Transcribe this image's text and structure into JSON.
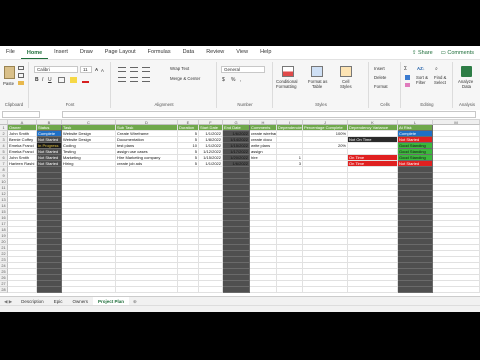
{
  "menu": {
    "tabs": [
      "File",
      "Home",
      "Insert",
      "Draw",
      "Page Layout",
      "Formulas",
      "Data",
      "Review",
      "View",
      "Help"
    ],
    "active": "Home",
    "share": "Share",
    "comments": "Comments"
  },
  "ribbon": {
    "clipboard": {
      "label": "Clipboard",
      "paste": "Paste"
    },
    "font": {
      "label": "Font",
      "name": "Calibri",
      "size": "11",
      "bold": "B",
      "italic": "I",
      "underline": "U"
    },
    "alignment": {
      "label": "Alignment",
      "wrap_text": "Wrap Text",
      "merge_center": "Merge & Center"
    },
    "number": {
      "label": "Number",
      "format": "General",
      "currency": "$",
      "percent": "%",
      "comma": ","
    },
    "styles": {
      "label": "Styles",
      "conditional": "Conditional",
      "conditional2": "Formatting",
      "format_table": "Format as",
      "format_table2": "Table",
      "cell_styles": "Cell",
      "cell_styles2": "Styles"
    },
    "cells": {
      "label": "Cells",
      "insert": "Insert",
      "delete": "Delete",
      "format": "Format"
    },
    "editing": {
      "label": "Editing",
      "sort": "Sort &",
      "sort2": "Filter",
      "find": "Find &",
      "find2": "Select"
    },
    "analysis": {
      "label": "Analysis",
      "analyze": "Analyze",
      "analyze2": "Data"
    }
  },
  "columns": [
    "A",
    "B",
    "C",
    "D",
    "E",
    "F",
    "G",
    "H",
    "I",
    "J",
    "K",
    "L",
    "M"
  ],
  "header_row": [
    "Owner",
    "Status",
    "Task",
    "Sub Task",
    "Duration",
    "Start Date",
    "End Date",
    "Comments",
    "Dependencies",
    "Percentage Complete",
    "Dependency Variance",
    "At Risk"
  ],
  "rows": [
    [
      "John Smith",
      "Complete",
      "Website Design",
      "Create Wireframe",
      "5",
      "1/1/2022",
      "1/6/2022",
      "create wireframe using t",
      "",
      "100%",
      "",
      "Complete"
    ],
    [
      "Bernie Coffey",
      "Not Started",
      "Website Design",
      "Documentation",
      "5",
      "1/8/2022",
      "1/14/2022",
      "create docu",
      "",
      "",
      "Not On Time",
      "Not Started"
    ],
    [
      "Emeka Franci",
      "In Progress",
      "Coding",
      "test plans",
      "10",
      "1/1/2022",
      "1/15/2022",
      "write plans",
      "",
      "20%",
      "",
      "Good Standing"
    ],
    [
      "Emeka Franci",
      "Not Started",
      "Testing",
      "assign use cases",
      "5",
      "1/12/2022",
      "1/17/2022",
      "assign",
      "",
      "",
      "",
      "Good Standing"
    ],
    [
      "John Smith",
      "Not Started",
      "Marketing",
      "Hire Marketing company",
      "5",
      "1/15/2022",
      "1/20/2022",
      "hire",
      "1",
      "",
      "On Time",
      "Good Standing"
    ],
    [
      "Harleen Rashi",
      "Not Started",
      "Hiring",
      "create job ads",
      "5",
      "1/1/2022",
      "1/6/2022",
      "",
      "3",
      "",
      "On Time",
      "Not Started"
    ]
  ],
  "row_numbers": [
    "1",
    "2",
    "3",
    "4",
    "5",
    "6",
    "7",
    "8",
    "9",
    "10",
    "11",
    "12",
    "13",
    "14",
    "15",
    "16",
    "17",
    "18",
    "19",
    "20",
    "21",
    "22",
    "23",
    "24",
    "25",
    "26",
    "27",
    "28"
  ],
  "sheet_tabs": [
    "Description",
    "Epic",
    "Owners",
    "Project Plan"
  ],
  "active_sheet": "Project Plan",
  "colors": {
    "header_green": "#6fa84b",
    "gray_col": "#4f4f4f",
    "complete_blue": "#1f6fc5",
    "in_progress_black": "#1a1a1a",
    "in_progress_text": "#e0c040",
    "risk_green": "#3cb83c",
    "risk_red": "#e02020"
  }
}
